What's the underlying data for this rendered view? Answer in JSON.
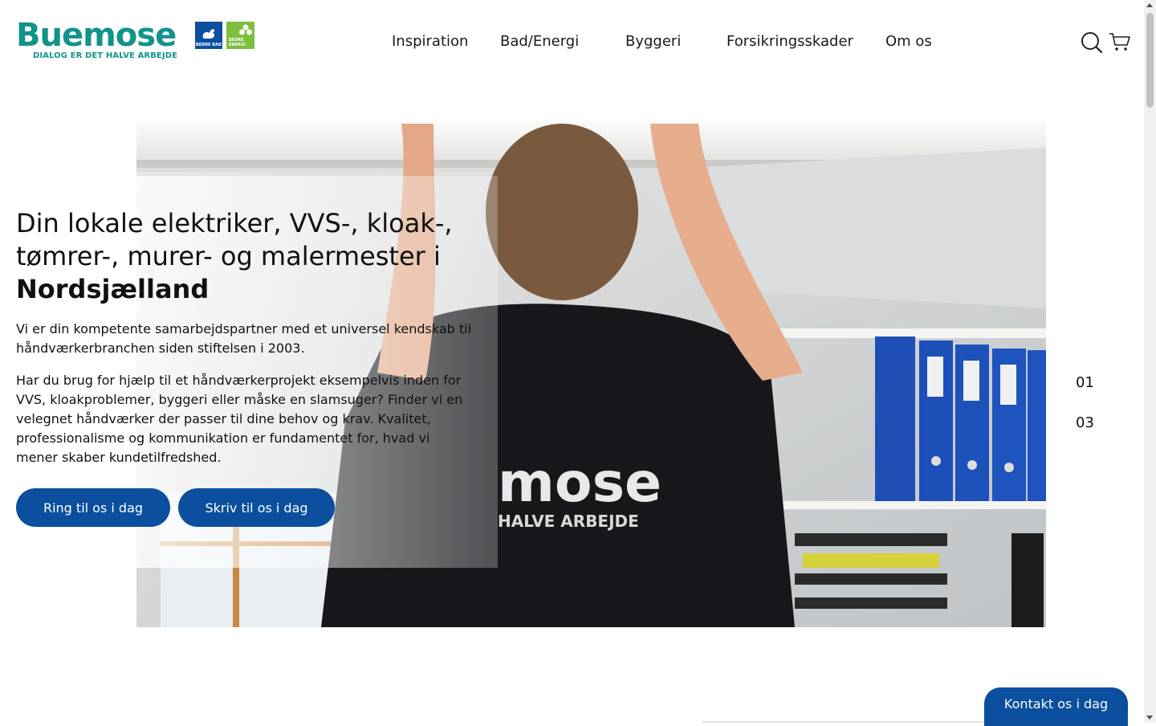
{
  "brand": {
    "name": "Buemose",
    "tagline": "DIALOG ER DET HALVE ARBEJDE",
    "badge_bad": "BEDRE BAD",
    "badge_energi": "BEDRE ENERGI",
    "primary_color": "#0b4f9e",
    "logo_color": "#12938a",
    "energi_color": "#7cbf3a"
  },
  "nav": {
    "items": [
      "Inspiration",
      "Bad/Energi",
      "Byggeri",
      "Forsikringsskader",
      "Om os"
    ]
  },
  "header_icons": [
    "search-icon",
    "cart-icon"
  ],
  "hero": {
    "title_line": "Din lokale elektriker, VVS-, kloak-, tømrer-, murer- og malermester i",
    "title_bold": "Nordsjælland",
    "paragraph1": "Vi er din kompetente samarbejdspartner med et universel kendskab til håndværkerbranchen siden stiftelsen i 2003.",
    "paragraph2": "Har du brug for hjælp til et håndværkerprojekt eksempelvis inden for VVS, kloakproblemer, byggeri eller måske en slamsuger? Finder vi en velegnet håndværker der passer til dine behov og krav. Kvalitet, professionalisme og kommunikation er fundamentet for, hvad vi mener skaber kundetilfredshed.",
    "btn_call": "Ring til os i dag",
    "btn_write": "Skriv til os i dag",
    "image_shirt_text": "mose",
    "image_shirt_subtext": "HALVE ARBEJDE"
  },
  "slider": {
    "current": "01",
    "total": "03"
  },
  "contact_button": "Kontakt os i dag"
}
